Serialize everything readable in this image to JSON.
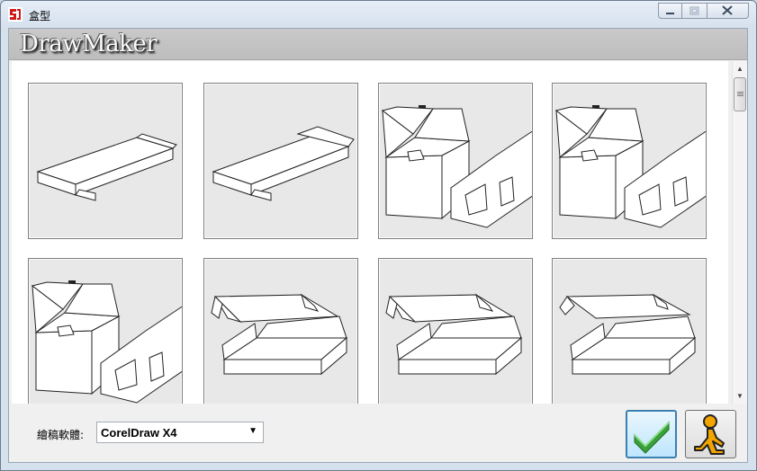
{
  "window": {
    "title": "盒型"
  },
  "banner": {
    "logo_text": "DrawMaker"
  },
  "gallery": {
    "items": [
      {
        "icon": "tray-box-lid-icon"
      },
      {
        "icon": "tray-box-lid-icon"
      },
      {
        "icon": "carton-box-open-icon"
      },
      {
        "icon": "carton-box-open-icon"
      },
      {
        "icon": "carton-box-open-icon"
      },
      {
        "icon": "mailer-box-open-icon"
      },
      {
        "icon": "mailer-box-open-icon"
      },
      {
        "icon": "mailer-box-open-icon"
      }
    ]
  },
  "software": {
    "label": "繪稿軟體:",
    "selected": "CorelDraw X4"
  },
  "buttons": {
    "ok_icon": "checkmark-icon",
    "user_icon": "running-man-icon"
  },
  "colors": {
    "banner_bg": "#c4c4c4",
    "ok_check": "#3aa13a",
    "user_figure": "#f2a400"
  }
}
